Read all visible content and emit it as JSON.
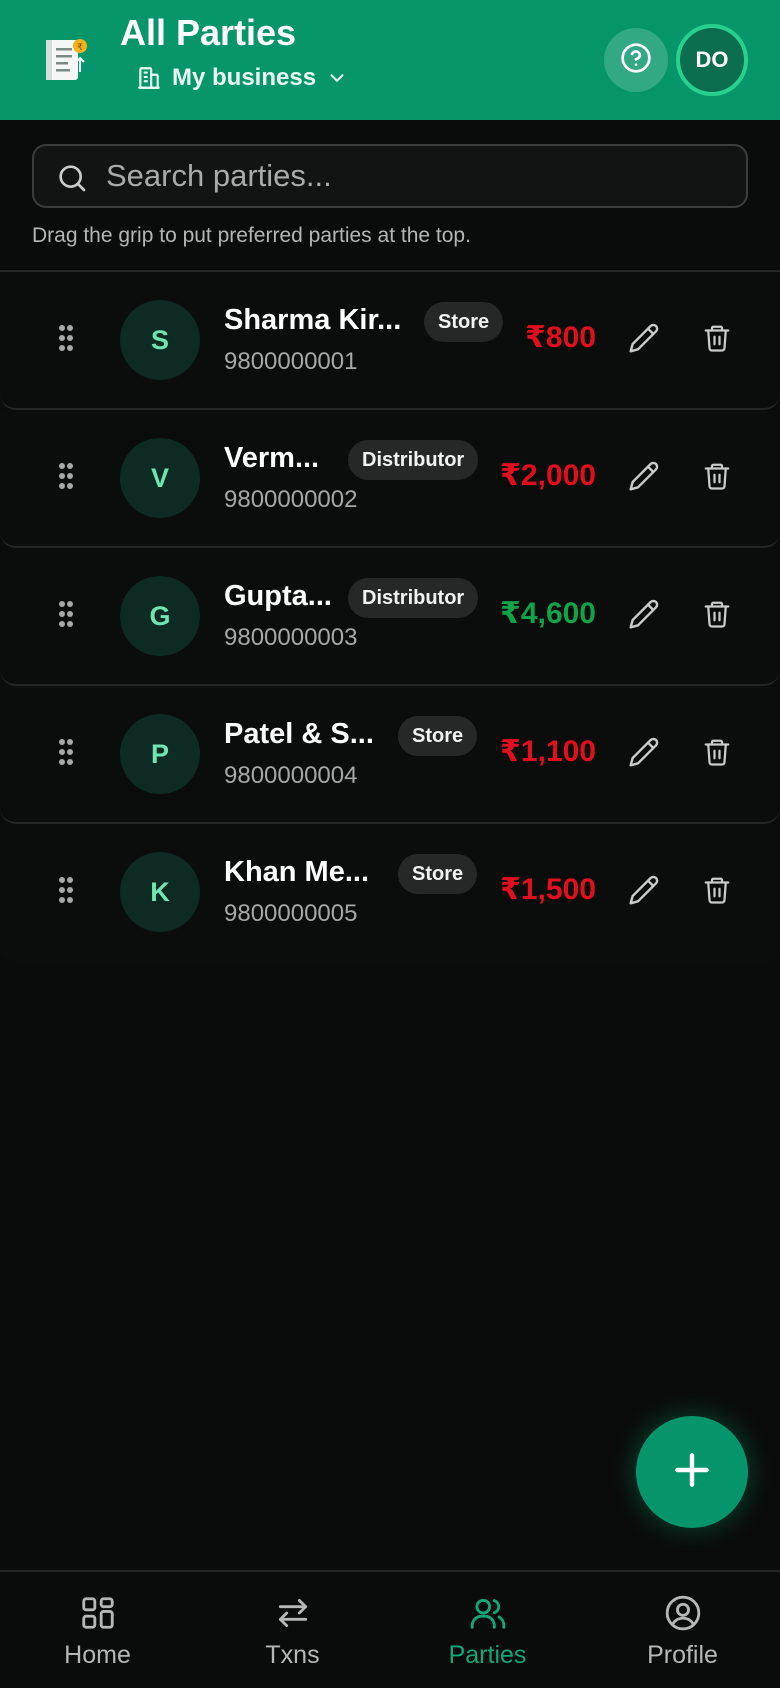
{
  "header": {
    "title": "All Parties",
    "business_name": "My business",
    "avatar_initials": "DO"
  },
  "search": {
    "placeholder": "Search parties...",
    "value": ""
  },
  "hint": "Drag the grip to put preferred parties at the top.",
  "parties": [
    {
      "initial": "S",
      "name": "Sharma Kir...",
      "type": "Store",
      "phone": "9800000001",
      "amount": "₹800",
      "status": "owed"
    },
    {
      "initial": "V",
      "name": "Verm...",
      "type": "Distributor",
      "phone": "9800000002",
      "amount": "₹2,000",
      "status": "owed"
    },
    {
      "initial": "G",
      "name": "Gupta...",
      "type": "Distributor",
      "phone": "9800000003",
      "amount": "₹4,600",
      "status": "receivable"
    },
    {
      "initial": "P",
      "name": "Patel & S...",
      "type": "Store",
      "phone": "9800000004",
      "amount": "₹1,100",
      "status": "owed"
    },
    {
      "initial": "K",
      "name": "Khan Me...",
      "type": "Store",
      "phone": "9800000005",
      "amount": "₹1,500",
      "status": "owed"
    }
  ],
  "colors": {
    "brand": "#069669",
    "negative": "#e10e1e",
    "positive": "#10a347"
  },
  "nav": {
    "items": [
      {
        "label": "Home",
        "icon": "grid-icon"
      },
      {
        "label": "Txns",
        "icon": "arrows-swap-icon"
      },
      {
        "label": "Parties",
        "icon": "users-icon",
        "active": true
      },
      {
        "label": "Profile",
        "icon": "user-circle-icon"
      }
    ]
  }
}
